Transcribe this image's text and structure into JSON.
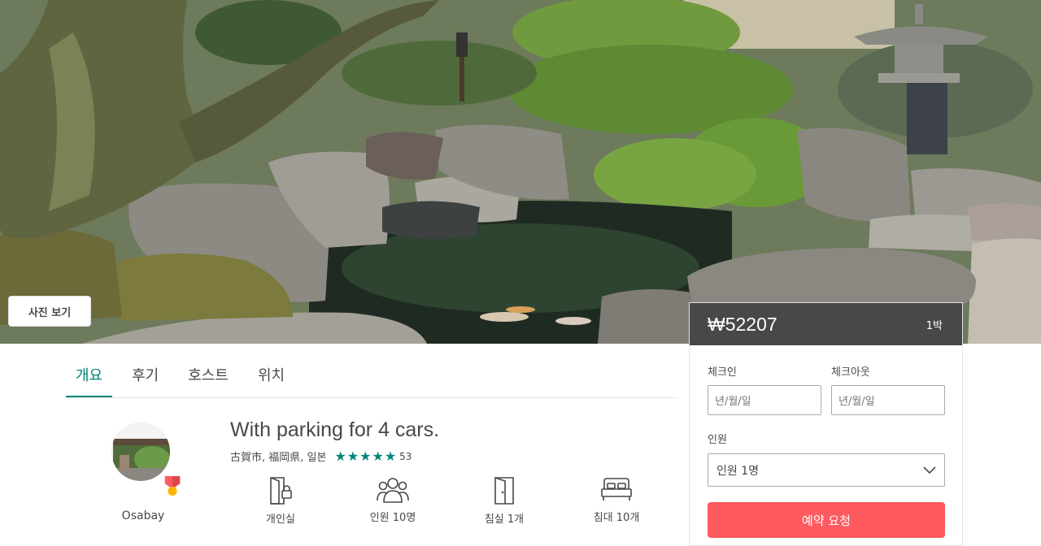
{
  "hero": {
    "photo_button_label": "사진 보기"
  },
  "tabs": [
    {
      "label": "개요",
      "active": true
    },
    {
      "label": "후기",
      "active": false
    },
    {
      "label": "호스트",
      "active": false
    },
    {
      "label": "위치",
      "active": false
    }
  ],
  "listing": {
    "title": "With parking for 4 cars.",
    "location": "古賀市, 福岡県, 일본",
    "rating_stars": 5,
    "review_count": "53",
    "host_name": "Osabay",
    "amenities": [
      {
        "icon": "door-lock-icon",
        "label": "개인실"
      },
      {
        "icon": "guests-icon",
        "label": "인원 10명"
      },
      {
        "icon": "door-icon",
        "label": "침실 1개"
      },
      {
        "icon": "bed-icon",
        "label": "침대 10개"
      }
    ]
  },
  "booking": {
    "price": "₩52207",
    "per_night": "1박",
    "checkin_label": "체크인",
    "checkout_label": "체크아웃",
    "checkin_placeholder": "년/월/일",
    "checkout_placeholder": "년/월/일",
    "guests_label": "인원",
    "guests_value": "인원 1명",
    "reserve_label": "예약 요청"
  },
  "colors": {
    "accent": "#00857a",
    "reserve": "#ff5a5f",
    "price_bar": "#484848"
  }
}
